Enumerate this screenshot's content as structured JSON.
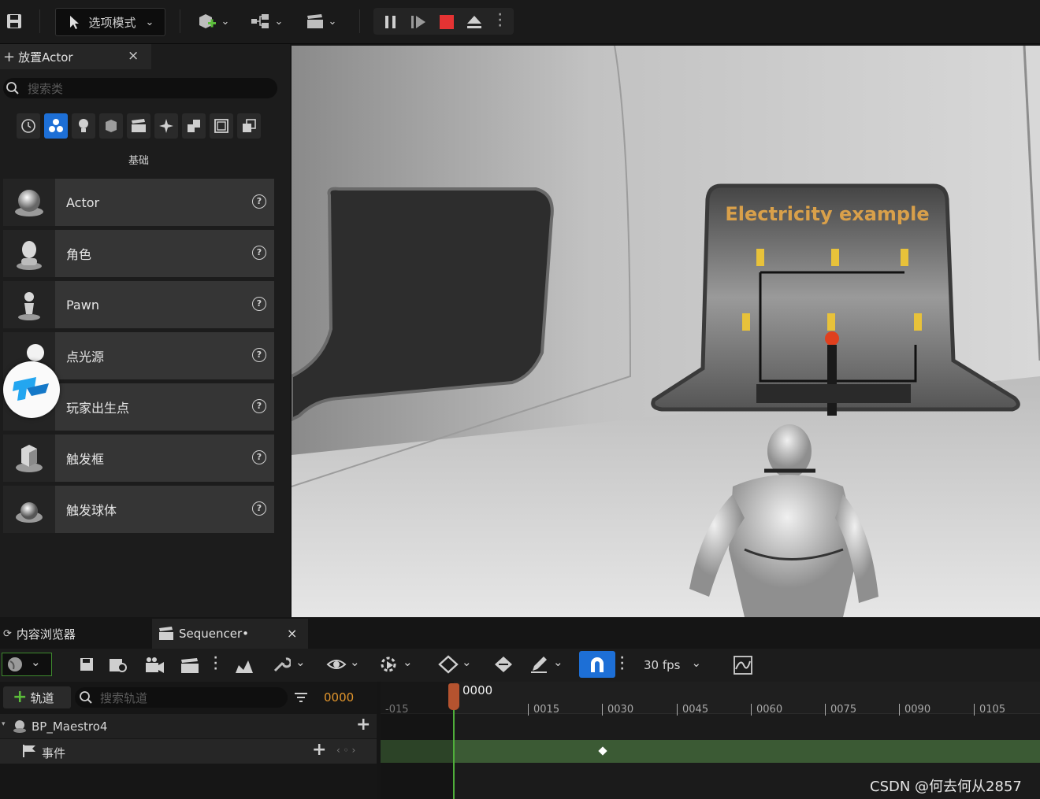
{
  "toolbar": {
    "mode_label": "选项模式",
    "icons": [
      "save-icon",
      "add-actor-icon",
      "blueprint-icon",
      "cinematics-icon",
      "pause-icon",
      "step-icon",
      "stop-icon",
      "eject-icon",
      "more-icon"
    ]
  },
  "place_actor": {
    "tab_title": "放置Actor",
    "close": "×",
    "search_placeholder": "搜索类",
    "category_title": "基础",
    "categories": [
      "recent",
      "basic",
      "lights",
      "shapes",
      "cinematic",
      "visual-effects",
      "geometry",
      "volumes",
      "all-classes"
    ],
    "items": [
      {
        "label": "Actor"
      },
      {
        "label": "角色"
      },
      {
        "label": "Pawn"
      },
      {
        "label": "点光源"
      },
      {
        "label": "玩家出生点"
      },
      {
        "label": "触发框"
      },
      {
        "label": "触发球体"
      }
    ],
    "help": "?"
  },
  "viewport": {
    "sign_text": "Electricity example"
  },
  "bottom_tabs": {
    "content_browser": "内容浏览器",
    "sequencer": "Sequencer•",
    "close": "×"
  },
  "sequencer": {
    "fps_label": "30 fps",
    "add_track_label": "轨道",
    "search_placeholder": "搜索轨道",
    "current_frame": "0000",
    "playhead_label": "0000",
    "ticks": [
      "-015",
      "0015",
      "0030",
      "0045",
      "0060",
      "0075",
      "0090",
      "0105"
    ],
    "tracks": [
      {
        "name": "BP_Maestro4"
      },
      {
        "name": "事件"
      }
    ]
  },
  "watermark": "CSDN @何去何从2857",
  "colors": {
    "accent": "#1d6fd6",
    "stop": "#e53333",
    "track_green": "#3b5a34",
    "playhead": "#b5532f"
  }
}
